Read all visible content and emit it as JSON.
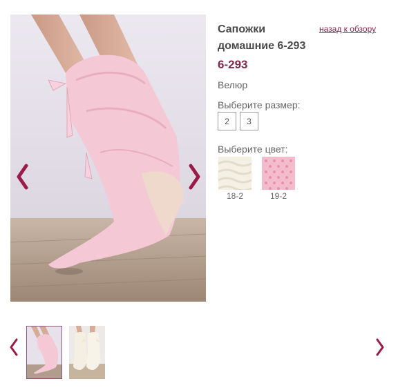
{
  "product": {
    "title": "Сапожки домашние 6-293",
    "sku": "6-293",
    "material": "Велюр",
    "back_link": "назад к обзору"
  },
  "sizes": {
    "label": "Выберите размер:",
    "options": [
      "2",
      "3"
    ]
  },
  "colors": {
    "label": "Выберите цвет:",
    "options": [
      {
        "code": "18-2",
        "swatch": "#f3efe3"
      },
      {
        "code": "19-2",
        "swatch": "#f1b9cb"
      }
    ]
  },
  "gallery": {
    "prev_icon": "chevron-left-icon",
    "next_icon": "chevron-right-icon",
    "thumbnails": [
      "pink-slipper-boots",
      "cream-slipper-boots"
    ]
  },
  "theme": {
    "accent": "#9b1b48",
    "link": "#7d2a4e"
  }
}
